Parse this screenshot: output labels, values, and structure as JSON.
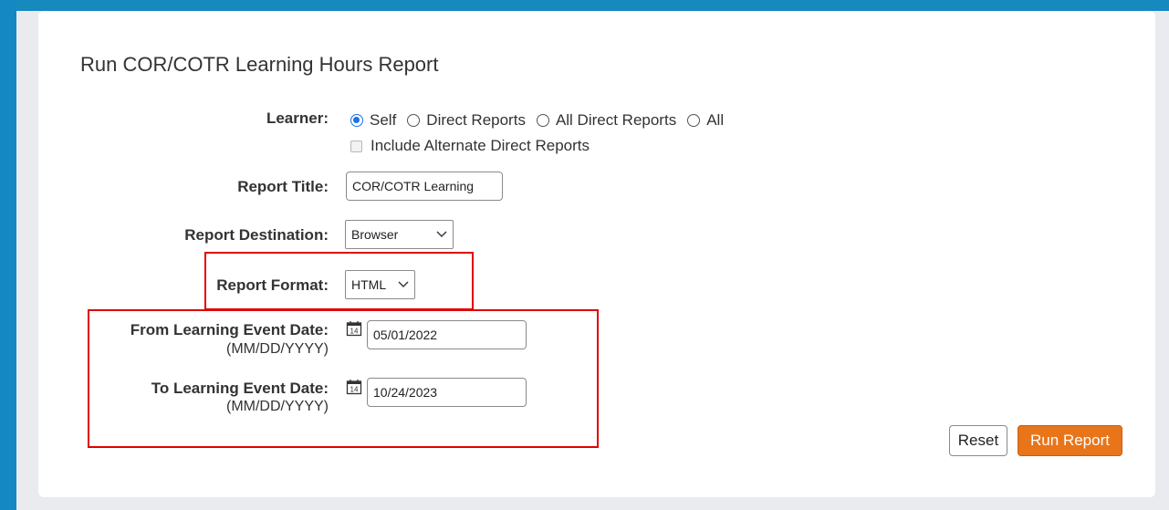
{
  "page": {
    "title": "Run COR/COTR Learning Hours Report"
  },
  "form": {
    "learner": {
      "label": "Learner:",
      "options": [
        "Self",
        "Direct Reports",
        "All Direct Reports",
        "All"
      ],
      "selected": "Self",
      "include_alternate_label": "Include Alternate Direct Reports",
      "include_alternate_checked": false
    },
    "report_title": {
      "label": "Report Title:",
      "value": "COR/COTR Learning"
    },
    "report_destination": {
      "label": "Report Destination:",
      "value": "Browser"
    },
    "report_format": {
      "label": "Report Format:",
      "value": "HTML"
    },
    "from_date": {
      "label": "From Learning Event Date:",
      "format_hint": "(MM/DD/YYYY)",
      "value": "05/01/2022",
      "icon_day": "14"
    },
    "to_date": {
      "label": "To Learning Event Date:",
      "format_hint": "(MM/DD/YYYY)",
      "value": "10/24/2023",
      "icon_day": "14"
    }
  },
  "actions": {
    "reset_label": "Reset",
    "run_label": "Run Report"
  },
  "colors": {
    "background": "#1689bf",
    "run_button": "#e8751a",
    "highlight": "#e00000",
    "radio_selected": "#1a73e8"
  }
}
